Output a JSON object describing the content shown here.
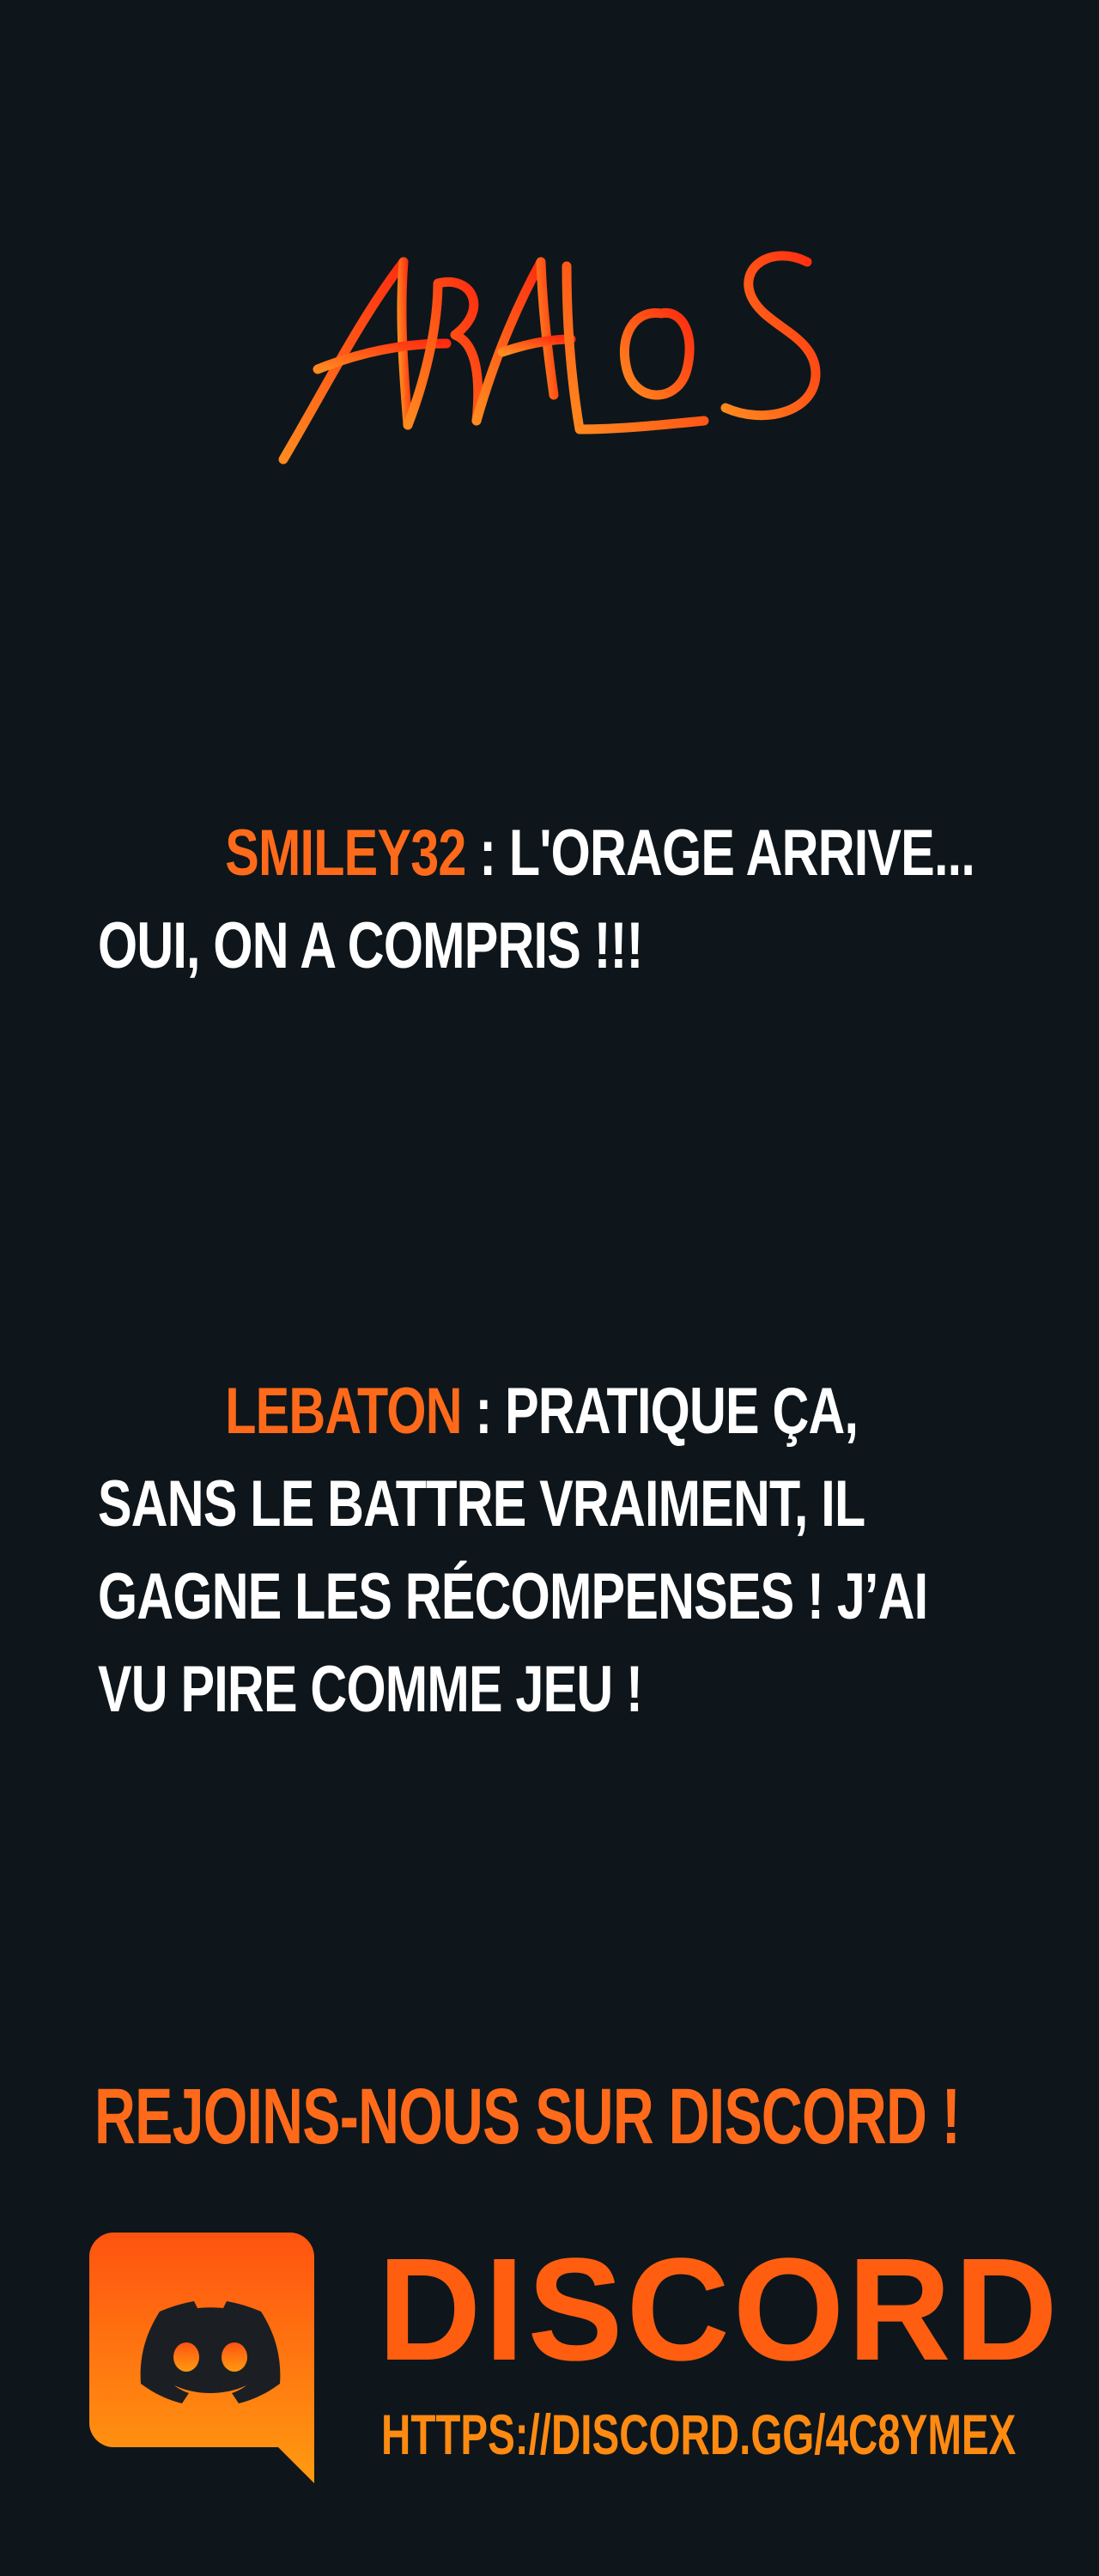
{
  "logo": {
    "text": "ARALOS",
    "colors": {
      "start": "#ff8a1f",
      "end": "#ff2b10"
    }
  },
  "comments": [
    {
      "author": "SMILEY32",
      "text": " : L'ORAGE ARRIVE... OUI, ON A COMPRIS !!!"
    },
    {
      "author": "LEBATON",
      "text": " : PRATIQUE ÇA, SANS LE BATTRE VRAIMENT, IL GAGNE LES RÉCOMPENSES ! J’AI VU PIRE COMME JEU !"
    }
  ],
  "cta": {
    "label": "REJOINS-NOUS SUR DISCORD !"
  },
  "discord": {
    "icon": "discord-icon",
    "word": "DISCORD",
    "url": "HTTPS://DISCORD.GG/4C8YMEX"
  },
  "colors": {
    "background": "#0e161b",
    "accent": "#ff6a1a",
    "text": "#ffffff"
  }
}
